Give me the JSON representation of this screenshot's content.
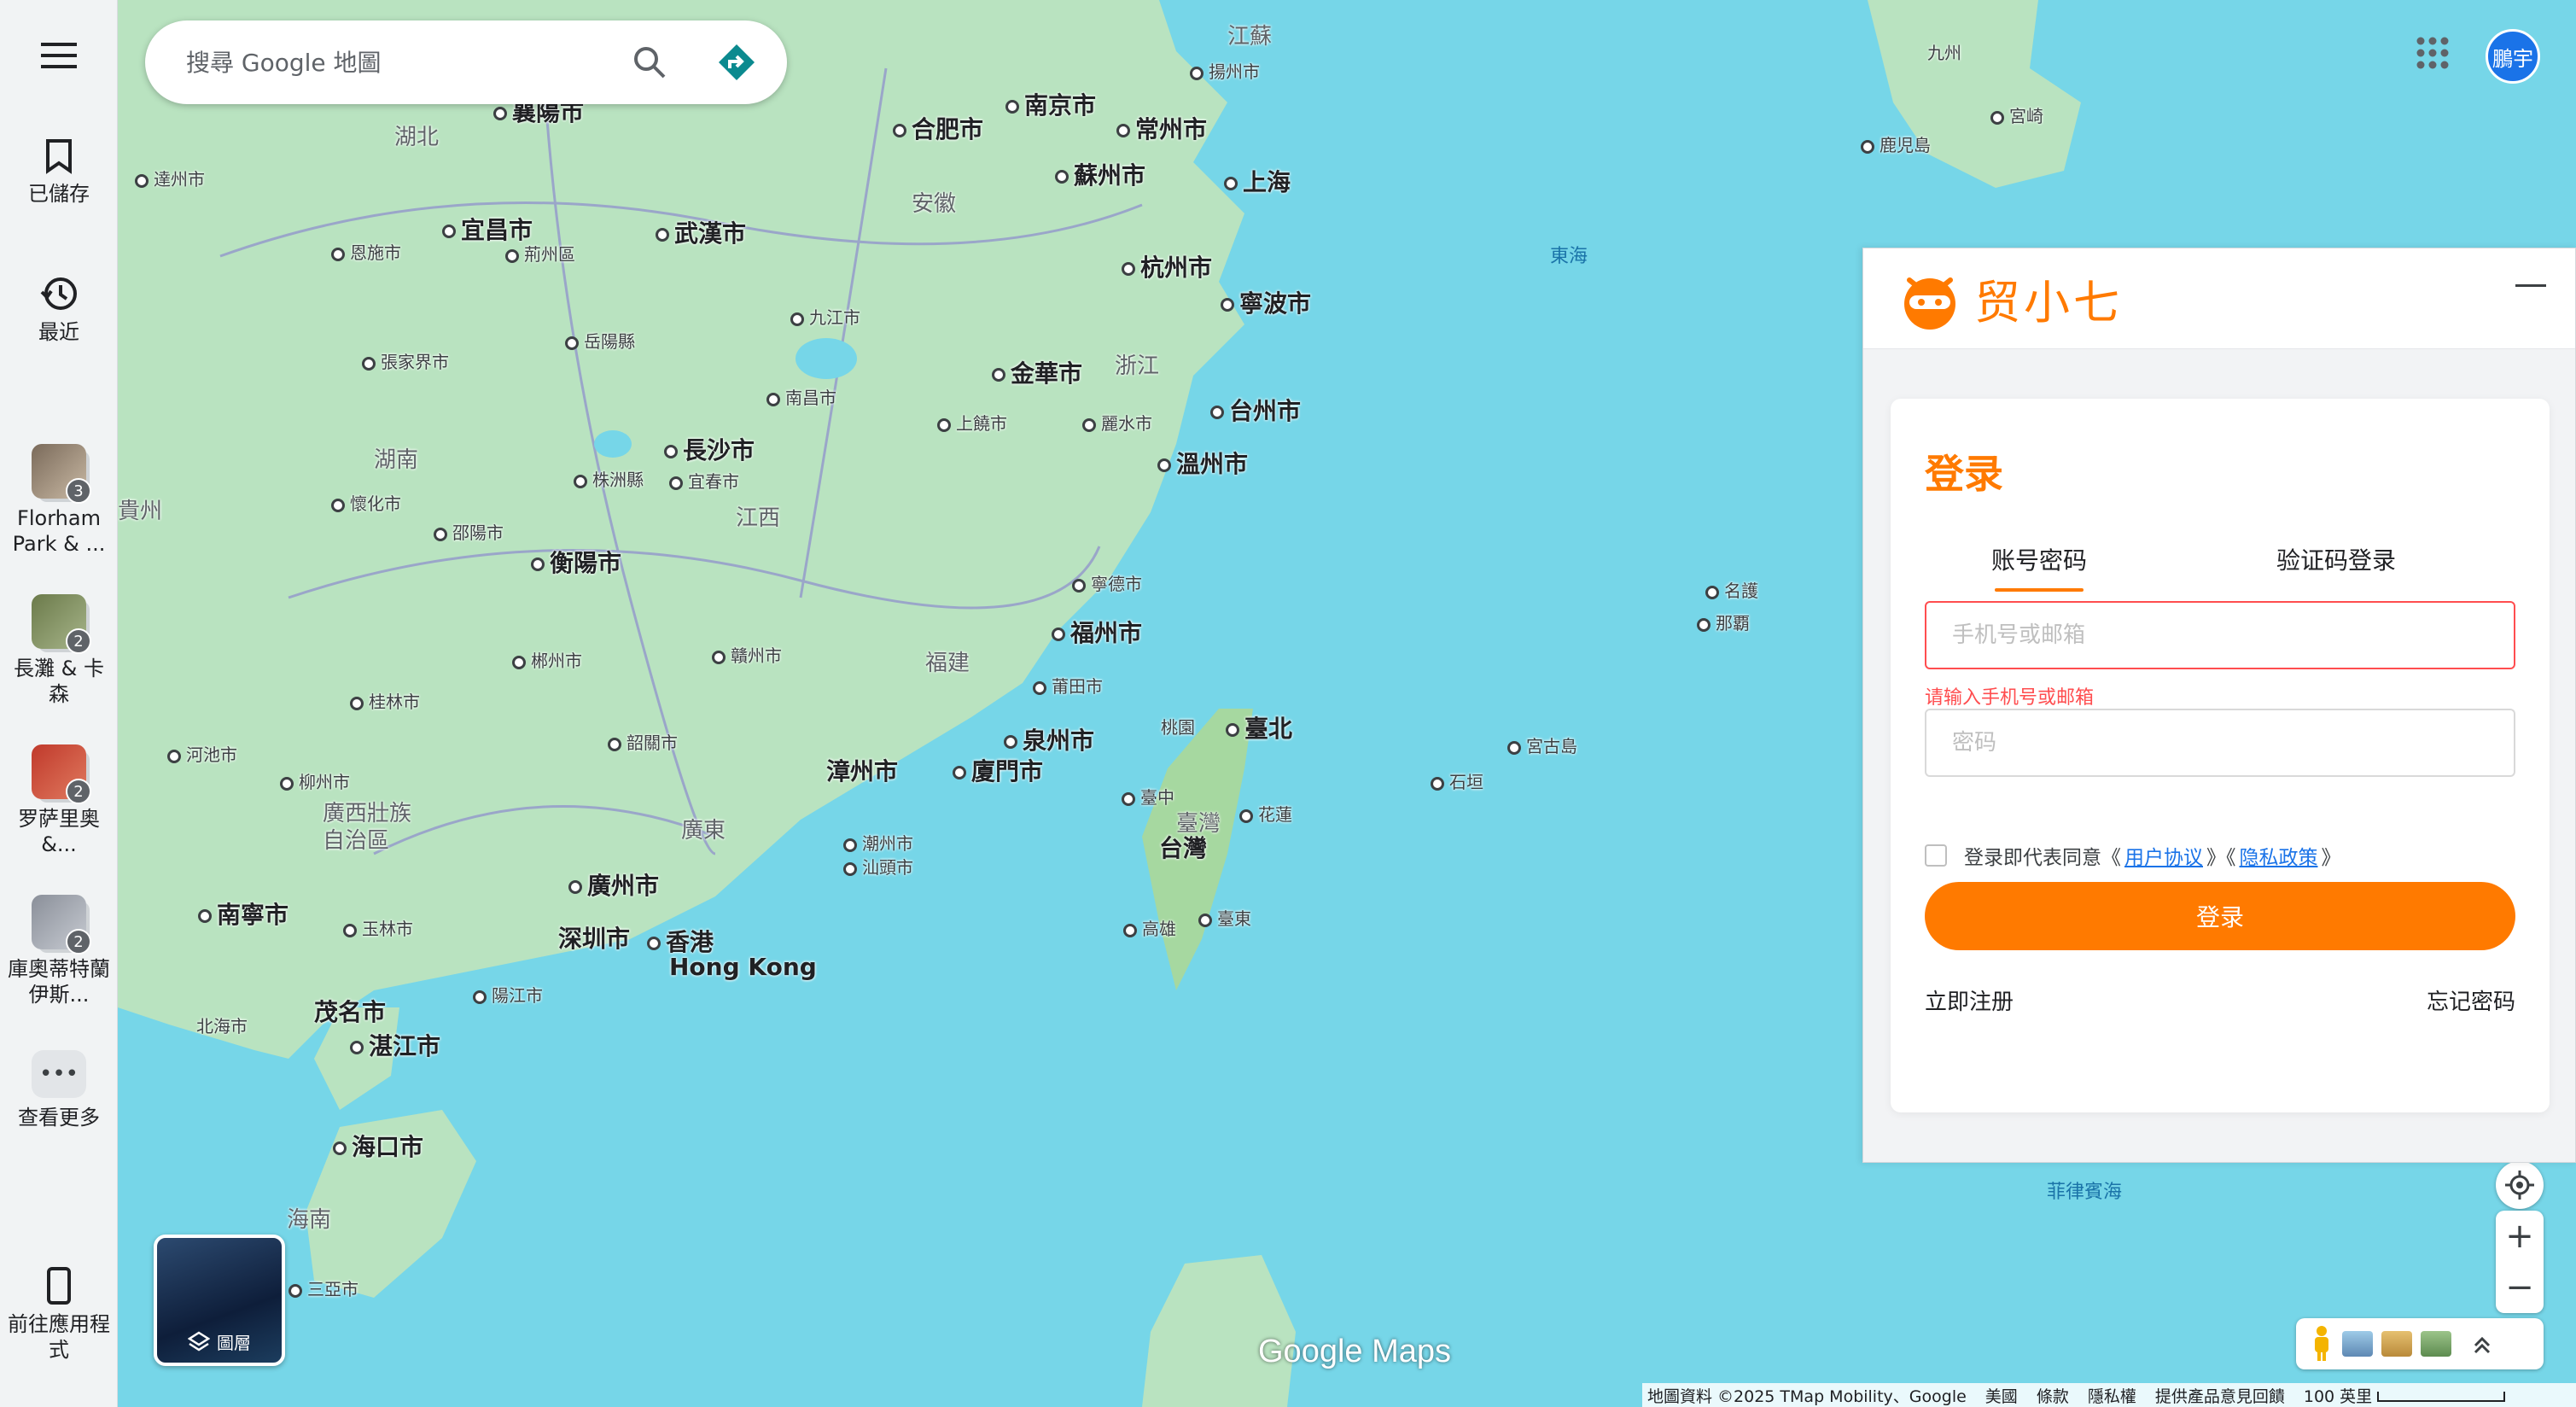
{
  "rail": {
    "saved_label": "已儲存",
    "recent_label": "最近",
    "recents": [
      {
        "label": "Florham Park & ...",
        "count": "3"
      },
      {
        "label": "長灘 & 卡森",
        "count": "2"
      },
      {
        "label": "罗萨里奥 &...",
        "count": "2"
      },
      {
        "label": "庫奧蒂特蘭伊斯...",
        "count": "2"
      }
    ],
    "more_label": "查看更多",
    "app_label": "前往應用程式"
  },
  "search": {
    "placeholder": "搜尋 Google 地圖"
  },
  "avatar": {
    "initials": "鵬宇"
  },
  "map": {
    "labels": [
      {
        "text": "江蘇",
        "cls": "prov"
      },
      {
        "text": "揚州市",
        "cls": "city-small dot"
      },
      {
        "text": "合肥市",
        "cls": "city-big dot"
      },
      {
        "text": "南京市",
        "cls": "city-big dot"
      },
      {
        "text": "常州市",
        "cls": "city-big dot"
      },
      {
        "text": "蘇州市",
        "cls": "city-big dot"
      },
      {
        "text": "上海",
        "cls": "city-big dot"
      },
      {
        "text": "安徽",
        "cls": "prov"
      },
      {
        "text": "湖北",
        "cls": "prov"
      },
      {
        "text": "襄陽市",
        "cls": "city-big dot"
      },
      {
        "text": "達州市",
        "cls": "city-small dot"
      },
      {
        "text": "宜昌市",
        "cls": "city-big dot"
      },
      {
        "text": "武漢市",
        "cls": "city-big dot"
      },
      {
        "text": "荊州區",
        "cls": "city-small dot"
      },
      {
        "text": "恩施市",
        "cls": "city-small dot"
      },
      {
        "text": "杭州市",
        "cls": "city-big dot"
      },
      {
        "text": "寧波市",
        "cls": "city-big dot"
      },
      {
        "text": "九江市",
        "cls": "city-small dot"
      },
      {
        "text": "岳陽縣",
        "cls": "city-small dot"
      },
      {
        "text": "張家界市",
        "cls": "city-small dot"
      },
      {
        "text": "金華市",
        "cls": "city-big dot"
      },
      {
        "text": "浙江",
        "cls": "prov"
      },
      {
        "text": "台州市",
        "cls": "city-big dot"
      },
      {
        "text": "南昌市",
        "cls": "city-small dot"
      },
      {
        "text": "上饒市",
        "cls": "city-small dot"
      },
      {
        "text": "麗水市",
        "cls": "city-small dot"
      },
      {
        "text": "溫州市",
        "cls": "city-big dot"
      },
      {
        "text": "湖南",
        "cls": "prov"
      },
      {
        "text": "長沙市",
        "cls": "city-big dot"
      },
      {
        "text": "株洲縣",
        "cls": "city-small dot"
      },
      {
        "text": "宜春市",
        "cls": "city-small dot"
      },
      {
        "text": "貴州",
        "cls": "prov"
      },
      {
        "text": "懷化市",
        "cls": "city-small dot"
      },
      {
        "text": "江西",
        "cls": "prov"
      },
      {
        "text": "邵陽市",
        "cls": "city-small dot"
      },
      {
        "text": "衡陽市",
        "cls": "city-big dot"
      },
      {
        "text": "寧德市",
        "cls": "city-small dot"
      },
      {
        "text": "福州市",
        "cls": "city-big dot"
      },
      {
        "text": "郴州市",
        "cls": "city-small dot"
      },
      {
        "text": "贛州市",
        "cls": "city-small dot"
      },
      {
        "text": "福建",
        "cls": "prov"
      },
      {
        "text": "莆田市",
        "cls": "city-small dot"
      },
      {
        "text": "桂林市",
        "cls": "city-small dot"
      },
      {
        "text": "韶關市",
        "cls": "city-small dot"
      },
      {
        "text": "泉州市",
        "cls": "city-big dot"
      },
      {
        "text": "河池市",
        "cls": "city-small dot"
      },
      {
        "text": "漳州市",
        "cls": "city-big"
      },
      {
        "text": "廈門市",
        "cls": "city-big dot"
      },
      {
        "text": "柳州市",
        "cls": "city-small dot"
      },
      {
        "text": "廣西壯族",
        "cls": "prov"
      },
      {
        "text": "自治區",
        "cls": "prov"
      },
      {
        "text": "廣東",
        "cls": "prov"
      },
      {
        "text": "潮州市",
        "cls": "city-small dot"
      },
      {
        "text": "汕頭市",
        "cls": "city-small dot"
      },
      {
        "text": "廣州市",
        "cls": "city-big dot"
      },
      {
        "text": "南寧市",
        "cls": "city-big dot"
      },
      {
        "text": "玉林市",
        "cls": "city-small dot"
      },
      {
        "text": "深圳市",
        "cls": "city-big"
      },
      {
        "text": "香港",
        "cls": "city-big dot"
      },
      {
        "text": "Hong Kong",
        "cls": "city-big"
      },
      {
        "text": "茂名市",
        "cls": "city-big"
      },
      {
        "text": "陽江市",
        "cls": "city-small dot"
      },
      {
        "text": "北海市",
        "cls": "city-small"
      },
      {
        "text": "湛江市",
        "cls": "city-big dot"
      },
      {
        "text": "海口市",
        "cls": "city-big dot"
      },
      {
        "text": "海南",
        "cls": "prov"
      },
      {
        "text": "三亞市",
        "cls": "city-small dot"
      },
      {
        "text": "桃園",
        "cls": "city-small"
      },
      {
        "text": "臺北",
        "cls": "city-big dot"
      },
      {
        "text": "臺中",
        "cls": "city-small dot"
      },
      {
        "text": "臺灣",
        "cls": "prov"
      },
      {
        "text": "花蓮",
        "cls": "city-small dot"
      },
      {
        "text": "台灣",
        "cls": "city-big"
      },
      {
        "text": "高雄",
        "cls": "city-small dot"
      },
      {
        "text": "臺東",
        "cls": "city-small dot"
      },
      {
        "text": "宮古島",
        "cls": "city-small dot"
      },
      {
        "text": "石垣",
        "cls": "city-small dot"
      },
      {
        "text": "名護",
        "cls": "city-small dot"
      },
      {
        "text": "那覇",
        "cls": "city-small dot"
      },
      {
        "text": "東海",
        "cls": "sea"
      },
      {
        "text": "菲律賓海",
        "cls": "sea"
      },
      {
        "text": "九州",
        "cls": "city-small"
      },
      {
        "text": "宮崎",
        "cls": "city-small dot"
      },
      {
        "text": "鹿児島",
        "cls": "city-small dot"
      }
    ]
  },
  "layers_label": "圖層",
  "brand_watermark": "Google Maps",
  "footer": {
    "attribution": "地圖資料 ©2025 TMap Mobility、Google",
    "region": "美國",
    "terms": "條款",
    "privacy": "隱私權",
    "feedback": "提供產品意見回饋",
    "scale": "100 英里"
  },
  "login": {
    "brand": "贸小七",
    "title": "登录",
    "tab_password": "账号密码",
    "tab_code": "验证码登录",
    "account_placeholder": "手机号或邮箱",
    "account_error": "请输入手机号或邮箱",
    "password_placeholder": "密码",
    "agree_prefix": "登录即代表同意《",
    "user_agreement": "用户协议",
    "agree_mid": "》《",
    "privacy_policy": "隐私政策",
    "agree_suffix": "》",
    "submit": "登录",
    "register": "立即注册",
    "forgot": "忘记密码"
  },
  "colors": {
    "accent": "#ff7a00",
    "error": "#ff4d4f",
    "link": "#1a73e8",
    "sea": "#76d6e8",
    "land": "#b9e3c0"
  }
}
